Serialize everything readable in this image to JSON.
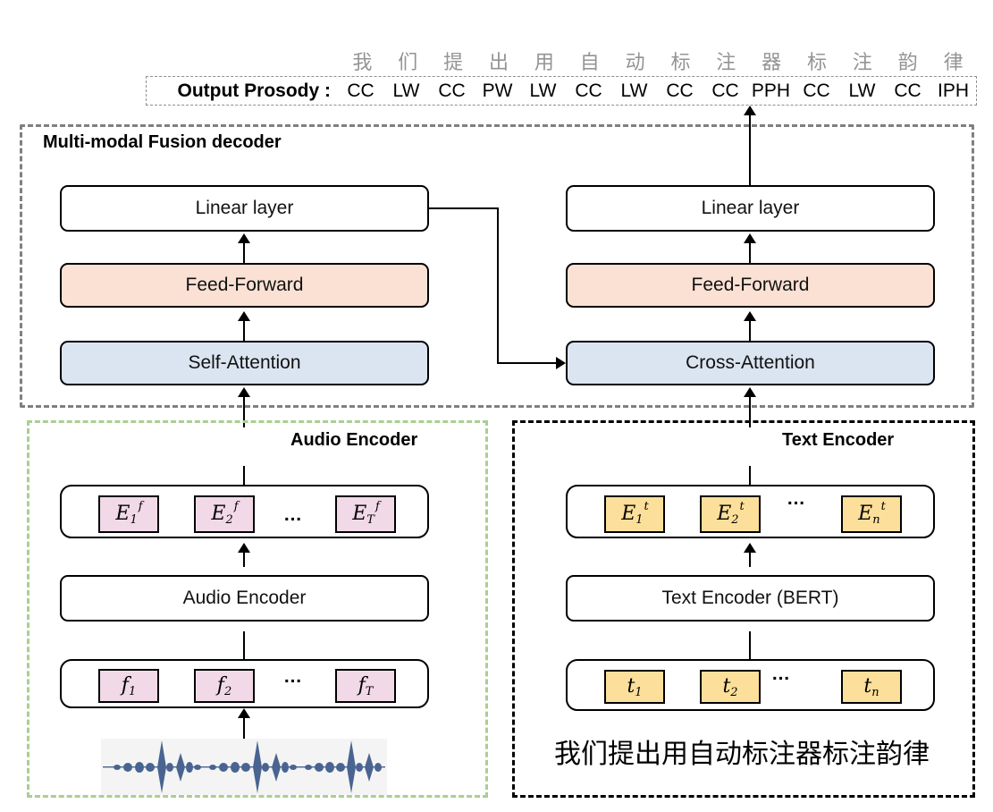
{
  "output": {
    "label": "Output Prosody :",
    "hanzi": [
      "我",
      "们",
      "提",
      "出",
      "用",
      "自",
      "动",
      "标",
      "注",
      "器",
      "标",
      "注",
      "韵",
      "律"
    ],
    "tags": [
      "CC",
      "LW",
      "CC",
      "PW",
      "LW",
      "CC",
      "LW",
      "CC",
      "CC",
      "PPH",
      "CC",
      "LW",
      "CC",
      "IPH"
    ]
  },
  "fusion": {
    "title": "Multi-modal Fusion decoder",
    "left_stack": {
      "linear": "Linear layer",
      "feed_forward": "Feed-Forward",
      "attention": "Self-Attention"
    },
    "right_stack": {
      "linear": "Linear layer",
      "feed_forward": "Feed-Forward",
      "attention": "Cross-Attention"
    }
  },
  "audio_encoder": {
    "title": "Audio Encoder",
    "encoder_block": "Audio Encoder",
    "embeddings": [
      {
        "base": "E",
        "sup": "f",
        "sub": "1"
      },
      {
        "base": "E",
        "sup": "f",
        "sub": "2"
      },
      {
        "base": "E",
        "sup": "f",
        "sub": "T"
      }
    ],
    "features": [
      {
        "base": "f",
        "sup": "",
        "sub": "1"
      },
      {
        "base": "f",
        "sup": "",
        "sub": "2"
      },
      {
        "base": "f",
        "sup": "",
        "sub": "T"
      }
    ],
    "ellipsis": "…"
  },
  "text_encoder": {
    "title": "Text Encoder",
    "encoder_block": "Text Encoder (BERT)",
    "embeddings": [
      {
        "base": "E",
        "sup": "t",
        "sub": "1"
      },
      {
        "base": "E",
        "sup": "t",
        "sub": "2"
      },
      {
        "base": "E",
        "sup": "t",
        "sub": "n"
      }
    ],
    "tokens": [
      {
        "base": "t",
        "sup": "",
        "sub": "1"
      },
      {
        "base": "t",
        "sup": "",
        "sub": "2"
      },
      {
        "base": "t",
        "sup": "",
        "sub": "n"
      }
    ],
    "ellipsis": "…",
    "input_sentence": "我们提出用自动标注器标注韵律"
  },
  "colors": {
    "feed_forward": "#fae1d4",
    "attention": "#dbe5f1",
    "audio_token": "#f1d9e7",
    "text_token": "#fcdf9a",
    "fusion_border": "#808080",
    "audio_border": "#a9cf91",
    "text_border": "#000000",
    "waveform": "#4a6491",
    "hanzi_text": "#949494"
  }
}
